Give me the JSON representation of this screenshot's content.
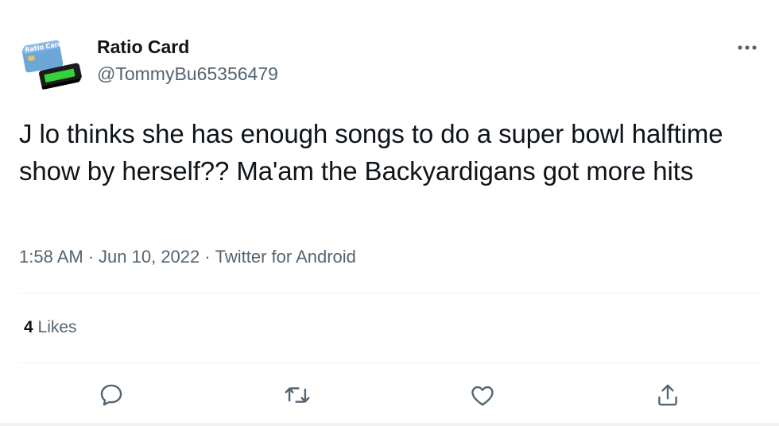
{
  "author": {
    "display_name": "Ratio Card",
    "handle": "@TommyBu65356479",
    "avatar_icon": "ratio-card-avatar-icon",
    "avatar_caption": "Ratio Card"
  },
  "tweet": {
    "text": "J lo thinks she has enough songs to do a super bowl halftime show by herself?? Ma'am the Backyardigans got more hits",
    "time": "1:58 AM",
    "date": "Jun 10, 2022",
    "source": "Twitter for Android",
    "separator": "·"
  },
  "stats": {
    "likes_count": "4",
    "likes_label": "Likes"
  },
  "actions": {
    "reply_icon": "reply-icon",
    "retweet_icon": "retweet-icon",
    "like_icon": "heart-icon",
    "share_icon": "share-icon",
    "more_icon": "more-icon"
  },
  "colors": {
    "text_primary": "#0f1419",
    "text_secondary": "#536471",
    "divider": "#eff3f4",
    "icon": "#536471"
  }
}
